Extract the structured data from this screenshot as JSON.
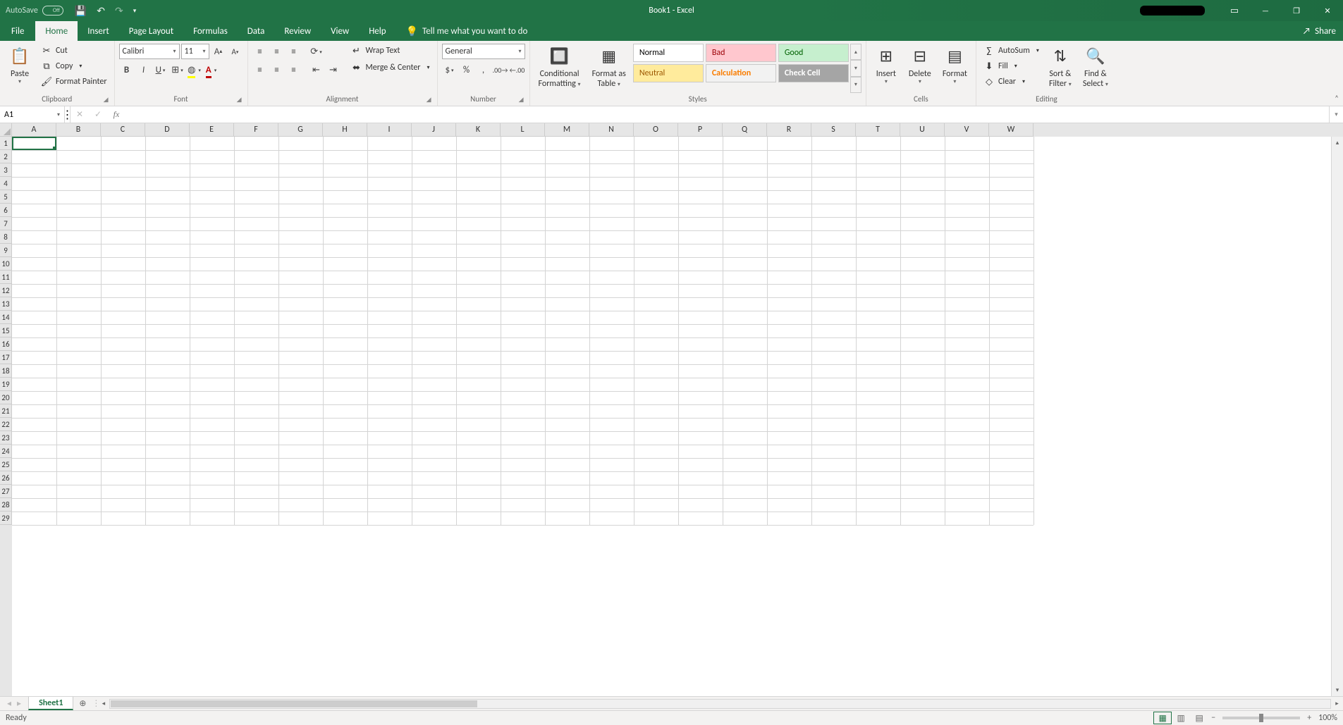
{
  "titlebar": {
    "autosave_label": "AutoSave",
    "autosave_state": "Off",
    "title": "Book1  -  Excel"
  },
  "tabs": {
    "file": "File",
    "home": "Home",
    "insert": "Insert",
    "page_layout": "Page Layout",
    "formulas": "Formulas",
    "data": "Data",
    "review": "Review",
    "view": "View",
    "help": "Help",
    "tellme": "Tell me what you want to do",
    "share": "Share"
  },
  "ribbon": {
    "clipboard": {
      "paste": "Paste",
      "cut": "Cut",
      "copy": "Copy",
      "format_painter": "Format Painter",
      "label": "Clipboard"
    },
    "font": {
      "name": "Calibri",
      "size": "11",
      "label": "Font"
    },
    "alignment": {
      "wrap": "Wrap Text",
      "merge": "Merge & Center",
      "label": "Alignment"
    },
    "number": {
      "format": "General",
      "label": "Number"
    },
    "styles": {
      "cond": "Conditional Formatting",
      "cond_l1": "Conditional",
      "cond_l2": "Formatting",
      "table": "Format as Table",
      "table_l1": "Format as",
      "table_l2": "Table",
      "normal": "Normal",
      "bad": "Bad",
      "good": "Good",
      "neutral": "Neutral",
      "calculation": "Calculation",
      "check_cell": "Check Cell",
      "label": "Styles"
    },
    "cells": {
      "insert": "Insert",
      "delete": "Delete",
      "format": "Format",
      "label": "Cells"
    },
    "editing": {
      "autosum": "AutoSum",
      "fill": "Fill",
      "clear": "Clear",
      "sort": "Sort & Filter",
      "sort_l1": "Sort &",
      "sort_l2": "Filter",
      "find": "Find & Select",
      "find_l1": "Find &",
      "find_l2": "Select",
      "label": "Editing"
    }
  },
  "namebox": {
    "value": "A1"
  },
  "columns": [
    "A",
    "B",
    "C",
    "D",
    "E",
    "F",
    "G",
    "H",
    "I",
    "J",
    "K",
    "L",
    "M",
    "N",
    "O",
    "P",
    "Q",
    "R",
    "S",
    "T",
    "U",
    "V",
    "W"
  ],
  "rows": [
    "1",
    "2",
    "3",
    "4",
    "5",
    "6",
    "7",
    "8",
    "9",
    "10",
    "11",
    "12",
    "13",
    "14",
    "15",
    "16",
    "17",
    "18",
    "19",
    "20",
    "21",
    "22",
    "23",
    "24",
    "25",
    "26",
    "27",
    "28",
    "29"
  ],
  "selected_cell": "A1",
  "sheets": {
    "s1": "Sheet1"
  },
  "status": {
    "ready": "Ready",
    "zoom": "100%"
  }
}
